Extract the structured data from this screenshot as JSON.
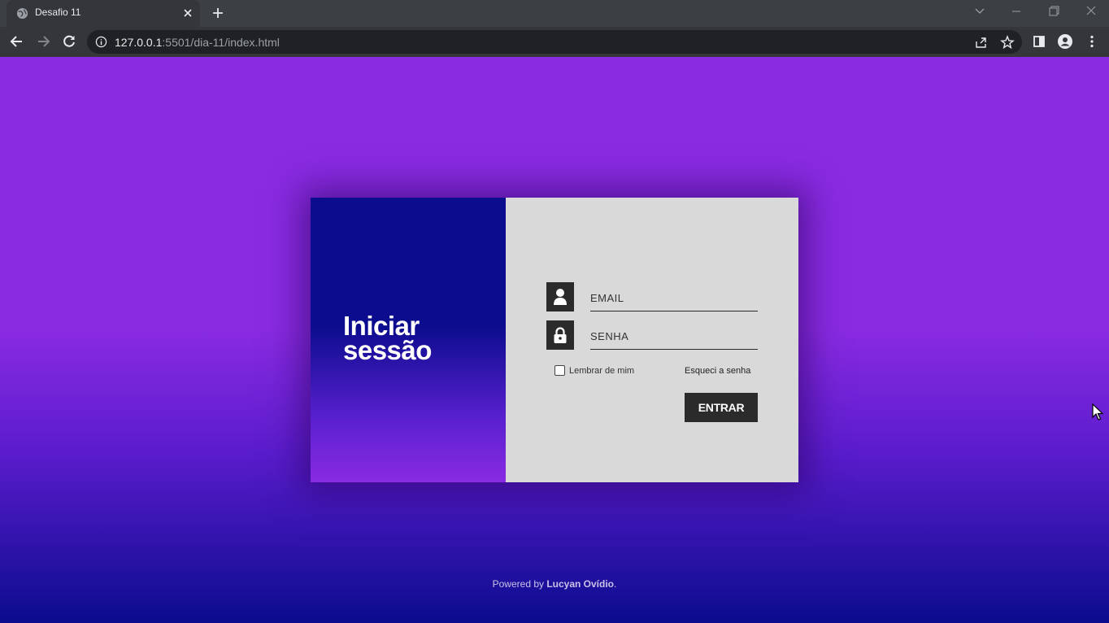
{
  "browser": {
    "tab_title": "Desafio 11",
    "url_host": "127.0.0.1",
    "url_rest": ":5501/dia-11/index.html",
    "icons": [
      "globe-icon",
      "close-icon",
      "plus-icon",
      "back-icon",
      "forward-icon",
      "reload-icon",
      "info-icon",
      "share-icon",
      "star-icon",
      "side-panel-icon",
      "profile-icon",
      "menu-icon",
      "chevron-down-icon",
      "minimize-icon",
      "restore-icon",
      "window-close-icon"
    ]
  },
  "login": {
    "title": "Iniciar sessão",
    "email_placeholder": "EMAIL",
    "password_placeholder": "SENHA",
    "remember_label": "Lembrar de mim",
    "forgot_label": "Esqueci a senha",
    "submit_label": "ENTRAR"
  },
  "footer": {
    "prefix": "Powered by ",
    "author": "Lucyan Ovídio",
    "suffix": "."
  },
  "colors": {
    "page_purple": "#8a2be2",
    "page_navy": "#0b0c8e",
    "card_panel": "#d9d9d9",
    "dark": "#2b2b2b"
  }
}
